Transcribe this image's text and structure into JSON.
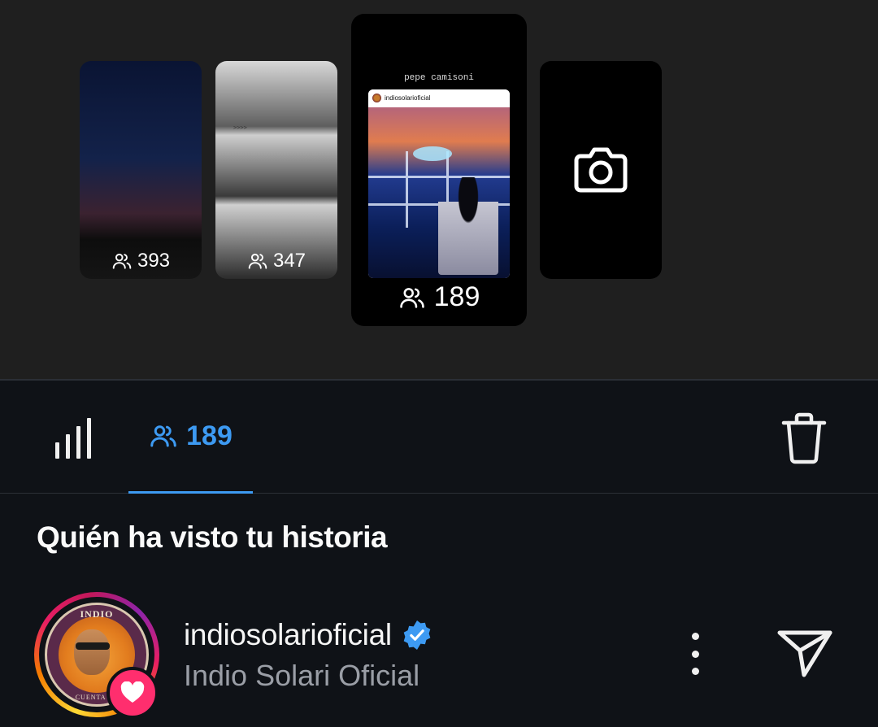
{
  "stories": [
    {
      "id": "story-1",
      "view_count": "393"
    },
    {
      "id": "story-2",
      "view_count": "347",
      "overlay_text": ">>>>"
    },
    {
      "id": "story-3",
      "view_count": "189",
      "caption": "pepe camisoni",
      "shared_account": "indiosolarioficial"
    }
  ],
  "camera_tile": {
    "icon": "camera-icon"
  },
  "tabs": {
    "insights_icon": "bar-chart-icon",
    "viewers_count": "189",
    "viewers_icon": "people-icon",
    "active_color": "#3d9af2"
  },
  "delete_icon": "trash-icon",
  "section_title": "Quién ha visto tu historia",
  "viewers": [
    {
      "username": "indiosolarioficial",
      "full_name": "Indio Solari Oficial",
      "verified": true,
      "liked": true,
      "avatar_seal_top": "INDIO",
      "avatar_seal_bottom": "CUENTA OF",
      "more_icon": "more-vertical-icon",
      "send_icon": "send-icon"
    }
  ],
  "colors": {
    "background": "#0f1217",
    "carousel_bg": "#1f1f1f",
    "like": "#ff2e6e",
    "verified": "#3d9af2",
    "secondary_text": "#9a9ea6"
  }
}
